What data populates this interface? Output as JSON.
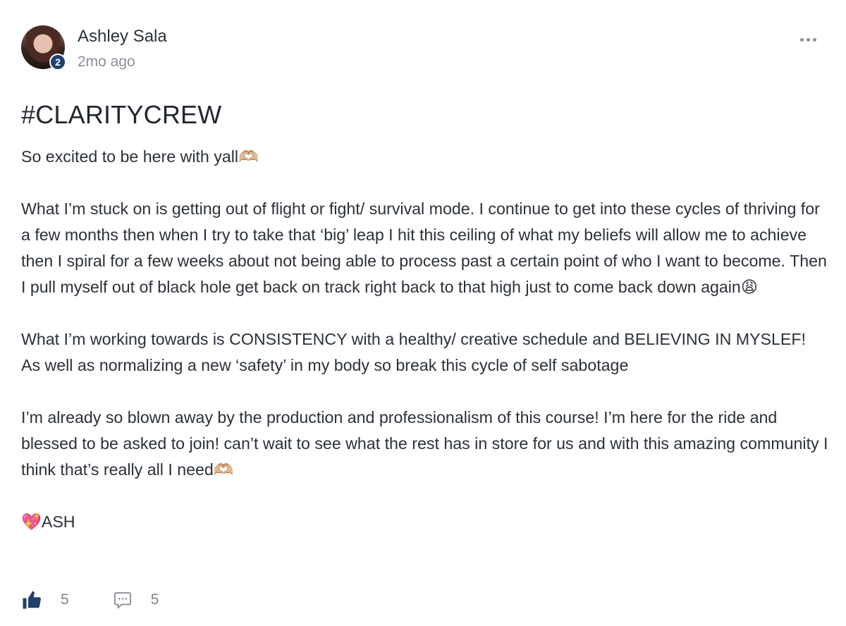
{
  "post": {
    "author": "Ashley Sala",
    "level": "2",
    "time_ago": "2mo ago",
    "title": "#CLARITYCREW",
    "paragraphs": [
      "So excited to be here with yall🫶🏼",
      "What I’m stuck on is getting out of flight or fight/ survival mode. I continue to get into these cycles of thriving for a few months then when I try to take that ‘big’ leap I hit this ceiling of what my beliefs will allow me to achieve then I spiral for a few weeks about not being able to process past a certain point of who I want to become. Then I pull myself out of black hole get back on track right back to that high just to come back down again😩",
      "What I’m working towards is CONSISTENCY with a healthy/ creative schedule and BELIEVING IN MYSLEF! As well as normalizing a new ‘safety’ in my body so break this cycle of self sabotage",
      "I’m already so blown away by the production and professionalism of this course! I’m here for the ride and blessed to be asked to join! can’t wait to see what the rest has in store for us and with this amazing community I think that’s really all I need🫶🏼",
      "💖ASH"
    ],
    "likes": "5",
    "comments": "5"
  },
  "icons": {
    "like": "thumbs-up-icon",
    "comment": "comment-icon",
    "menu": "more-horizontal-icon"
  },
  "colors": {
    "like_icon": "#21406e",
    "badge": "#21406e",
    "muted_text": "#8a9098"
  }
}
